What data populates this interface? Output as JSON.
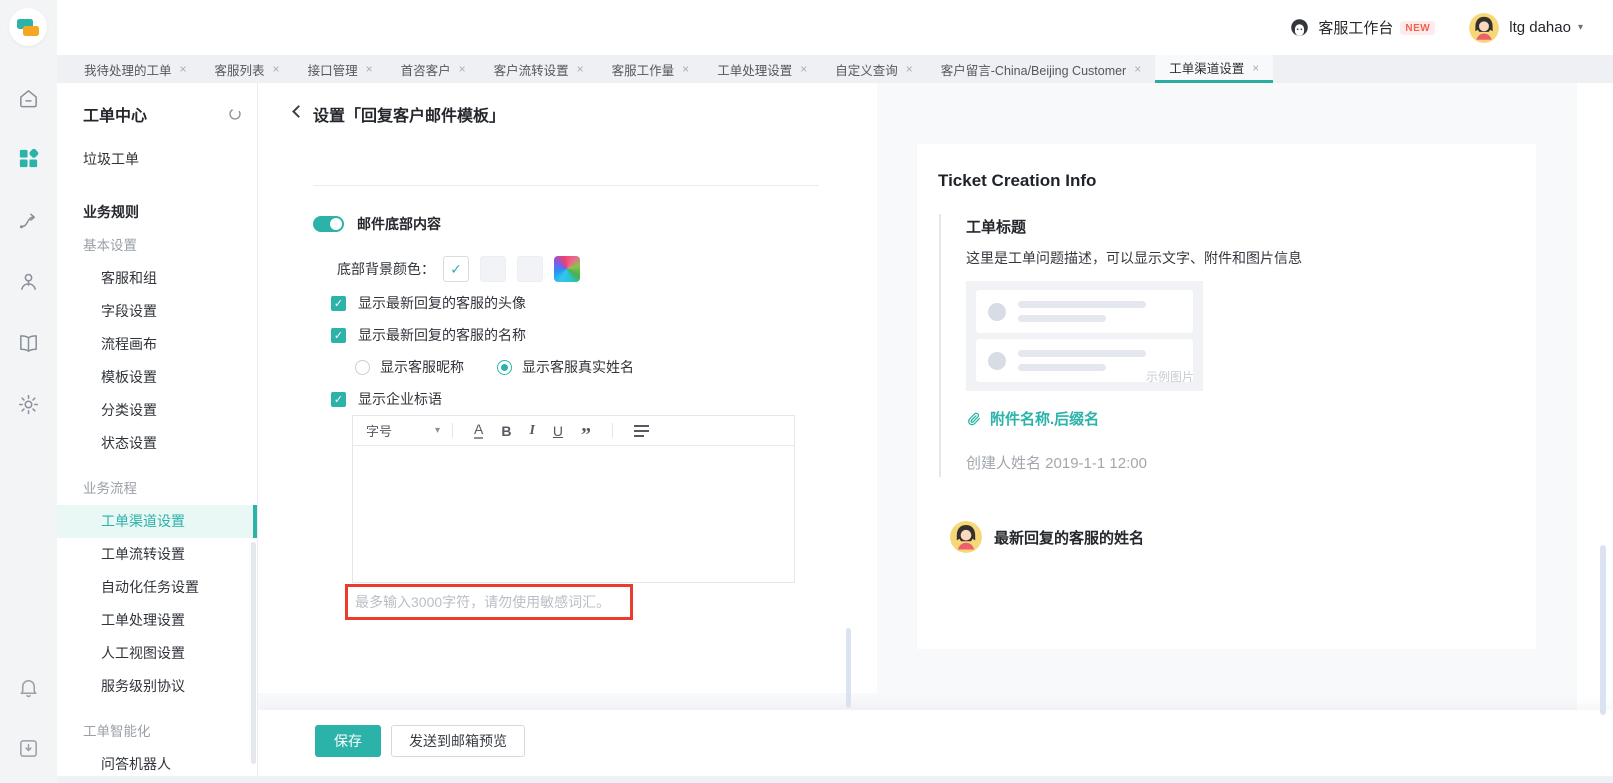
{
  "glyphs": {
    "close": "×",
    "caret_down": "▾",
    "check": "✓"
  },
  "topbar": {
    "workbench_label": "客服工作台",
    "new_badge": "NEW",
    "username": "ltg dahao"
  },
  "tabs": [
    {
      "label": "我待处理的工单"
    },
    {
      "label": "客服列表"
    },
    {
      "label": "接口管理"
    },
    {
      "label": "首咨客户"
    },
    {
      "label": "客户流转设置"
    },
    {
      "label": "客服工作量"
    },
    {
      "label": "工单处理设置"
    },
    {
      "label": "自定义查询"
    },
    {
      "label": "客户留言-China/Beijing Customer"
    },
    {
      "label": "工单渠道设置"
    }
  ],
  "sidebar": {
    "title": "工单中心",
    "items": [
      {
        "label": "垃圾工单"
      },
      {
        "label": "业务规则"
      },
      {
        "label": "基本设置"
      },
      {
        "label": "客服和组"
      },
      {
        "label": "字段设置"
      },
      {
        "label": "流程画布"
      },
      {
        "label": "模板设置"
      },
      {
        "label": "分类设置"
      },
      {
        "label": "状态设置"
      },
      {
        "label": "业务流程"
      },
      {
        "label": "工单渠道设置"
      },
      {
        "label": "工单流转设置"
      },
      {
        "label": "自动化任务设置"
      },
      {
        "label": "工单处理设置"
      },
      {
        "label": "人工视图设置"
      },
      {
        "label": "服务级别协议"
      },
      {
        "label": "工单智能化"
      },
      {
        "label": "问答机器人"
      }
    ]
  },
  "page_header": {
    "title": "设置「回复客户邮件模板」"
  },
  "form": {
    "footer_toggle_label": "邮件底部内容",
    "bg_color_label": "底部背景颜色：",
    "checkbox_avatar": "显示最新回复的客服的头像",
    "checkbox_name": "显示最新回复的客服的名称",
    "radio_nickname": "显示客服昵称",
    "radio_realname": "显示客服真实姓名",
    "checkbox_slogan": "显示企业标语",
    "editor": {
      "font_size": "字号",
      "color": "A",
      "bold": "B",
      "italic": "I",
      "underline": "U",
      "quote": "”"
    },
    "hint": "最多输入3000字符，请勿使用敏感词汇。"
  },
  "footer_actions": {
    "save": "保存",
    "preview": "发送到邮箱预览"
  },
  "preview_panel": {
    "title": "Ticket Creation Info",
    "ticket_title": "工单标题",
    "ticket_desc": "这里是工单问题描述，可以显示文字、附件和图片信息",
    "sample_image_label": "示例图片",
    "attachment_name": "附件名称.后缀名",
    "creator_line": "创建人姓名 2019-1-1 12:00",
    "latest_reply_label": "最新回复的客服的姓名"
  },
  "colors": {
    "brand_teal": "#2bb3a9",
    "annotation_red": "#ea3b2e",
    "new_badge_red": "#f5604f"
  }
}
